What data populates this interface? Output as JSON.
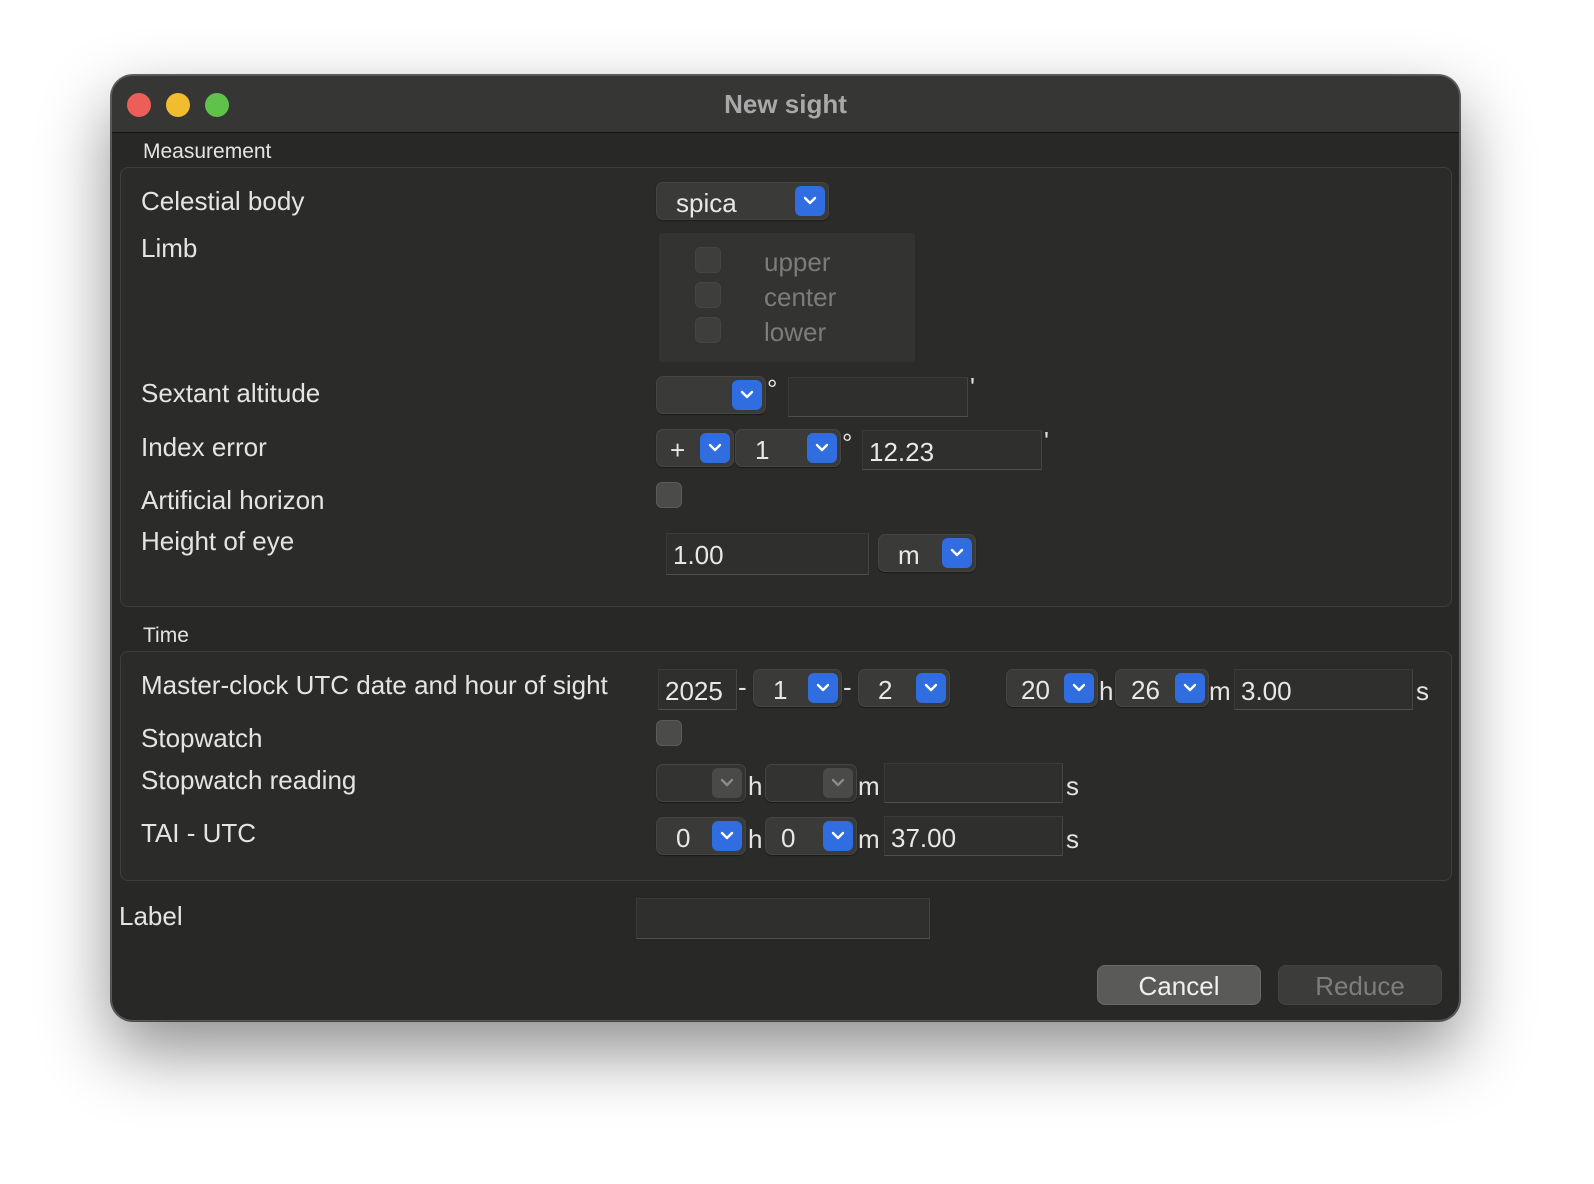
{
  "window": {
    "title": "New sight"
  },
  "measurement": {
    "group_title": "Measurement",
    "celestial_body": {
      "label": "Celestial body",
      "value": "spica"
    },
    "limb": {
      "label": "Limb",
      "options": [
        "upper",
        "center",
        "lower"
      ]
    },
    "sextant_altitude": {
      "label": "Sextant altitude",
      "degrees": "",
      "degree_symbol": "°",
      "minutes": "",
      "minute_symbol": "'"
    },
    "index_error": {
      "label": "Index error",
      "sign": "+",
      "degrees": "1",
      "degree_symbol": "°",
      "minutes": "12.23",
      "minute_symbol": "'"
    },
    "artificial_horizon": {
      "label": "Artificial horizon",
      "checked": false
    },
    "height_of_eye": {
      "label": "Height of eye",
      "value": "1.00",
      "unit": "m"
    }
  },
  "time": {
    "group_title": "Time",
    "master_clock": {
      "label": "Master-clock UTC date and hour of sight",
      "year": "2025",
      "sep1": "-",
      "month": "1",
      "sep2": "-",
      "day": "2",
      "hour": "20",
      "h": "h",
      "minute": "26",
      "m": "m",
      "seconds": "3.00",
      "s": "s"
    },
    "stopwatch": {
      "label": "Stopwatch",
      "checked": false
    },
    "stopwatch_reading": {
      "label": "Stopwatch reading",
      "hours": "",
      "h": "h",
      "minutes": "",
      "m": "m",
      "seconds": "",
      "s": "s"
    },
    "tai_utc": {
      "label": "TAI - UTC",
      "hours": "0",
      "h": "h",
      "minutes": "0",
      "m": "m",
      "seconds": "37.00",
      "s": "s"
    }
  },
  "label": {
    "label": "Label",
    "value": ""
  },
  "buttons": {
    "cancel": "Cancel",
    "reduce": "Reduce"
  },
  "colors": {
    "accent": "#2f6de0",
    "window_bg": "#282826"
  }
}
